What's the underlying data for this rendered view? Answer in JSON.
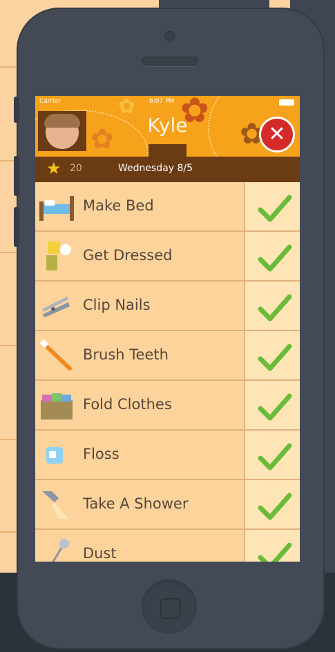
{
  "status_bar": {
    "carrier": "Carrier",
    "time": "6:07 PM"
  },
  "header": {
    "kid_name": "Kyle"
  },
  "summary": {
    "points": "20",
    "date": "Wednesday 8/5"
  },
  "chores": [
    {
      "label": "Make Bed",
      "icon": "bed-icon",
      "done": true
    },
    {
      "label": "Get Dressed",
      "icon": "clothes-icon",
      "done": true
    },
    {
      "label": "Clip Nails",
      "icon": "nail-clipper-icon",
      "done": true
    },
    {
      "label": "Brush Teeth",
      "icon": "toothbrush-icon",
      "done": true
    },
    {
      "label": "Fold Clothes",
      "icon": "laundry-basket-icon",
      "done": true
    },
    {
      "label": "Floss",
      "icon": "floss-icon",
      "done": true
    },
    {
      "label": "Take A Shower",
      "icon": "shower-icon",
      "done": true
    },
    {
      "label": "Dust",
      "icon": "duster-icon",
      "done": true
    }
  ],
  "colors": {
    "header": "#f6a21a",
    "subbar": "#6b3b14",
    "row_bg": "#fdd39c",
    "check": "#6bbb3a",
    "close": "#d42a2a"
  }
}
